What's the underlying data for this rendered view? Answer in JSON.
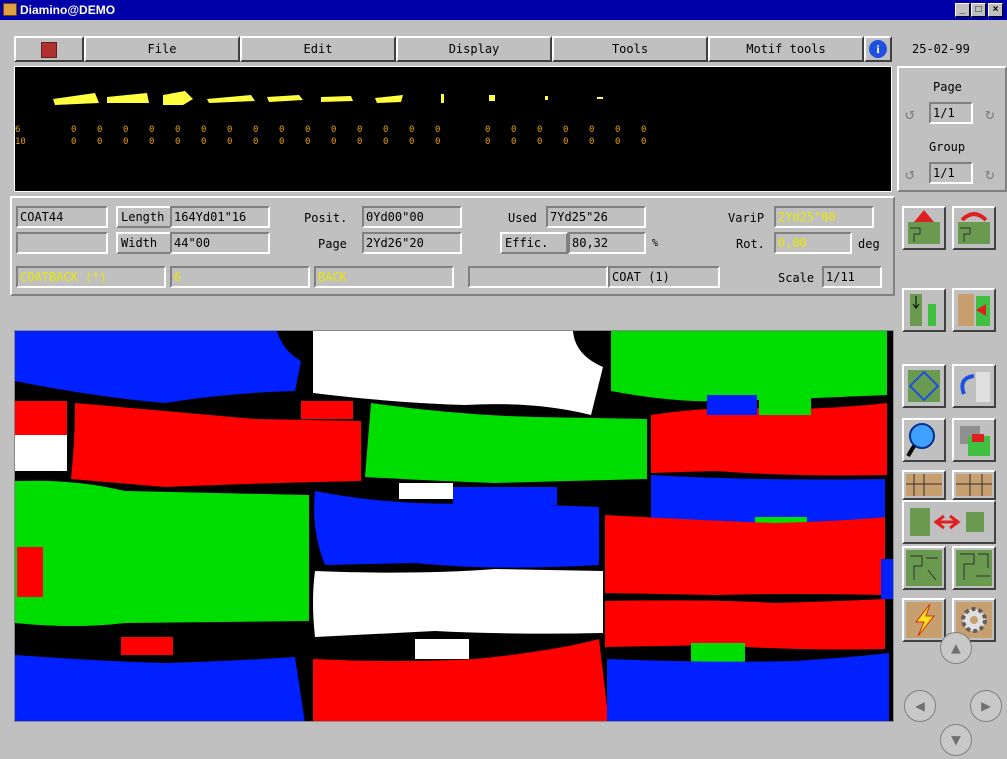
{
  "window": {
    "title": "Diamino@DEMO",
    "controls": [
      "_",
      "□",
      "×"
    ]
  },
  "menu": {
    "file": "File",
    "edit": "Edit",
    "display": "Display",
    "tools": "Tools",
    "motif_tools": "Motif tools",
    "info_icon": "info-icon",
    "logo_icon": "logo-icon"
  },
  "date": "25-02-99",
  "preview": {
    "row1_label": "6",
    "row2_label": "10",
    "row1_values": [
      "0",
      "0",
      "0",
      "0",
      "0",
      "0",
      "0",
      "0",
      "0",
      "0",
      "0",
      "0",
      "0",
      "0",
      "0",
      "0",
      "0",
      "0",
      "0",
      "0",
      "0",
      "0"
    ],
    "row2_values": [
      "0",
      "0",
      "0",
      "0",
      "0",
      "0",
      "0",
      "0",
      "0",
      "0",
      "0",
      "0",
      "0",
      "0",
      "0",
      "0",
      "0",
      "0",
      "0",
      "0",
      "0",
      "0"
    ]
  },
  "nav_panel": {
    "page_label": "Page",
    "page_value": "1/1",
    "group_label": "Group",
    "group_value": "1/1"
  },
  "info": {
    "model": "COAT44",
    "length_label": "Length",
    "length_value": "164Yd01\"16",
    "width_label": "Width",
    "width_value": "44\"00",
    "posit_label": "Posit.",
    "posit_value": "0Yd00\"00",
    "page_label": "Page",
    "page_value": "2Yd26\"20",
    "used_label": "Used",
    "used_value": "7Yd25\"26",
    "effic_label": "Effic.",
    "effic_value": "80,32",
    "effic_unit": "%",
    "varip_label": "VariP",
    "varip_value": "2Yd25\"00",
    "rot_label": "Rot.",
    "rot_value": "0,00",
    "rot_unit": "deg",
    "piece_name": "COATBACK (*)",
    "piece_size": "6",
    "piece_type": "BACK",
    "piece_blank": "",
    "piece_model": "COAT (1)",
    "scale_label": "Scale",
    "scale_value": "1/11"
  },
  "colors": {
    "blue": "#0020ff",
    "white": "#ffffff",
    "green": "#00dd00",
    "red": "#ff0000",
    "yellow": "#e8e800",
    "title_bg": "#0000a8"
  }
}
